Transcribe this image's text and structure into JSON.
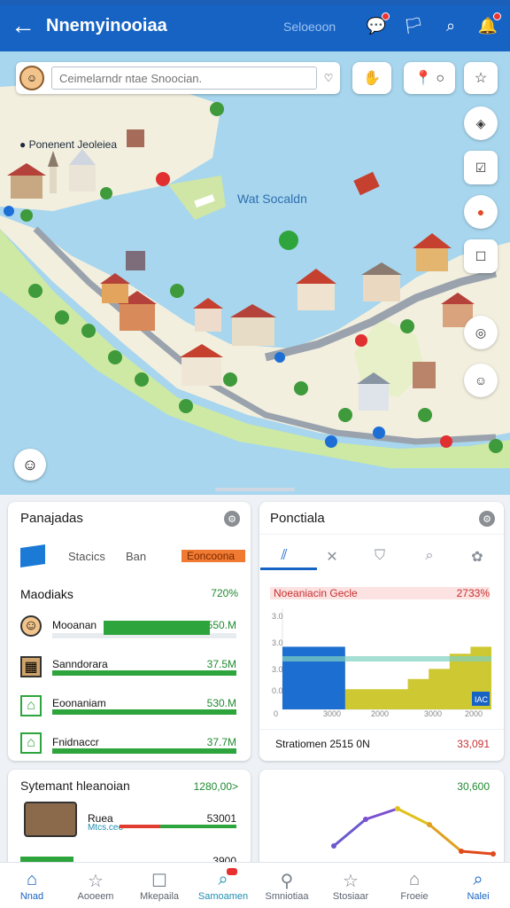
{
  "header": {
    "title": "Nnemyinooiaa",
    "subtitle": "Seloeoon",
    "back_icon": "arrow-left-icon",
    "icons": [
      "chat-icon",
      "flag-icon",
      "search-icon",
      "notification-icon"
    ]
  },
  "map": {
    "search_placeholder": "Ceimelarndr ntae Snoocian.",
    "region_label": "Ponenent Jeoleiea",
    "sea_label": "Wat Socaldn",
    "top_buttons": [
      "hand-icon",
      "location-icon",
      "star-icon"
    ],
    "side_buttons": [
      "layers-icon",
      "checklist-icon",
      "record-icon",
      "chat-icon",
      "compass-icon",
      "smile-icon"
    ]
  },
  "card_left": {
    "title": "Panajadas",
    "segments": [
      "Stacics",
      "Ban",
      "Eoncoona"
    ],
    "section_title": "Maodiaks",
    "section_value": "720%",
    "rows": [
      {
        "label": "Mooanan",
        "value": "550.M",
        "fill": 0.8
      },
      {
        "label": "Sanndorara",
        "value": "37.5M",
        "fill": 1.0
      },
      {
        "label": "Eoonaniam",
        "value": "530.M",
        "fill": 1.0
      },
      {
        "label": "Fnidnaccr",
        "value": "37.7M",
        "fill": 1.0
      }
    ]
  },
  "card_right": {
    "title": "Ponctiala",
    "legend_label": "Noeaniacin Gecle",
    "legend_value": "2733%",
    "y_ticks": [
      "3.0",
      "3.0",
      "3.0",
      "0.0",
      "0"
    ],
    "x_ticks": [
      "3000",
      "2000",
      "3000",
      "2000"
    ],
    "badge": "IAC",
    "footer_label": "Stratiomen 2515 0N",
    "footer_value": "33,091",
    "chart_data": {
      "type": "area",
      "series": [
        {
          "values": [
            0.55,
            0.55,
            0.55,
            0.2,
            0.2,
            0.2,
            0.3,
            0.4,
            0.55,
            0.62,
            0.85
          ]
        },
        {
          "values": [
            0.62,
            0.62,
            0.62,
            0.0,
            0.0,
            0.0,
            0.0,
            0.0,
            0.0,
            0.0,
            0.0
          ]
        }
      ]
    }
  },
  "card_bottom_left": {
    "title": "Sytemant hleanoian",
    "value": "1280,00>",
    "row_label": "Ruea",
    "row_sub": "Mtcs.ceo",
    "row_value": "53001",
    "row_fill": 0.35,
    "row2_value": "3900"
  },
  "card_bottom_right": {
    "value": "30,600",
    "chart_data": {
      "type": "line",
      "series": [
        {
          "values": [
            0.2,
            0.7,
            0.9,
            0.6,
            0.1,
            0.05
          ]
        }
      ]
    }
  },
  "nav": {
    "items": [
      {
        "label": "Nnad",
        "icon": "home-icon"
      },
      {
        "label": "Aooeem",
        "icon": "star-icon"
      },
      {
        "label": "Mkepaila",
        "icon": "chat-icon"
      },
      {
        "label": "Samoamen",
        "icon": "search-icon"
      },
      {
        "label": "Smniotiaa",
        "icon": "pin-icon"
      },
      {
        "label": "Stosiaar",
        "icon": "star-icon"
      },
      {
        "label": "Froeie",
        "icon": "home-icon"
      },
      {
        "label": "Nalei",
        "icon": "search-icon"
      }
    ]
  }
}
